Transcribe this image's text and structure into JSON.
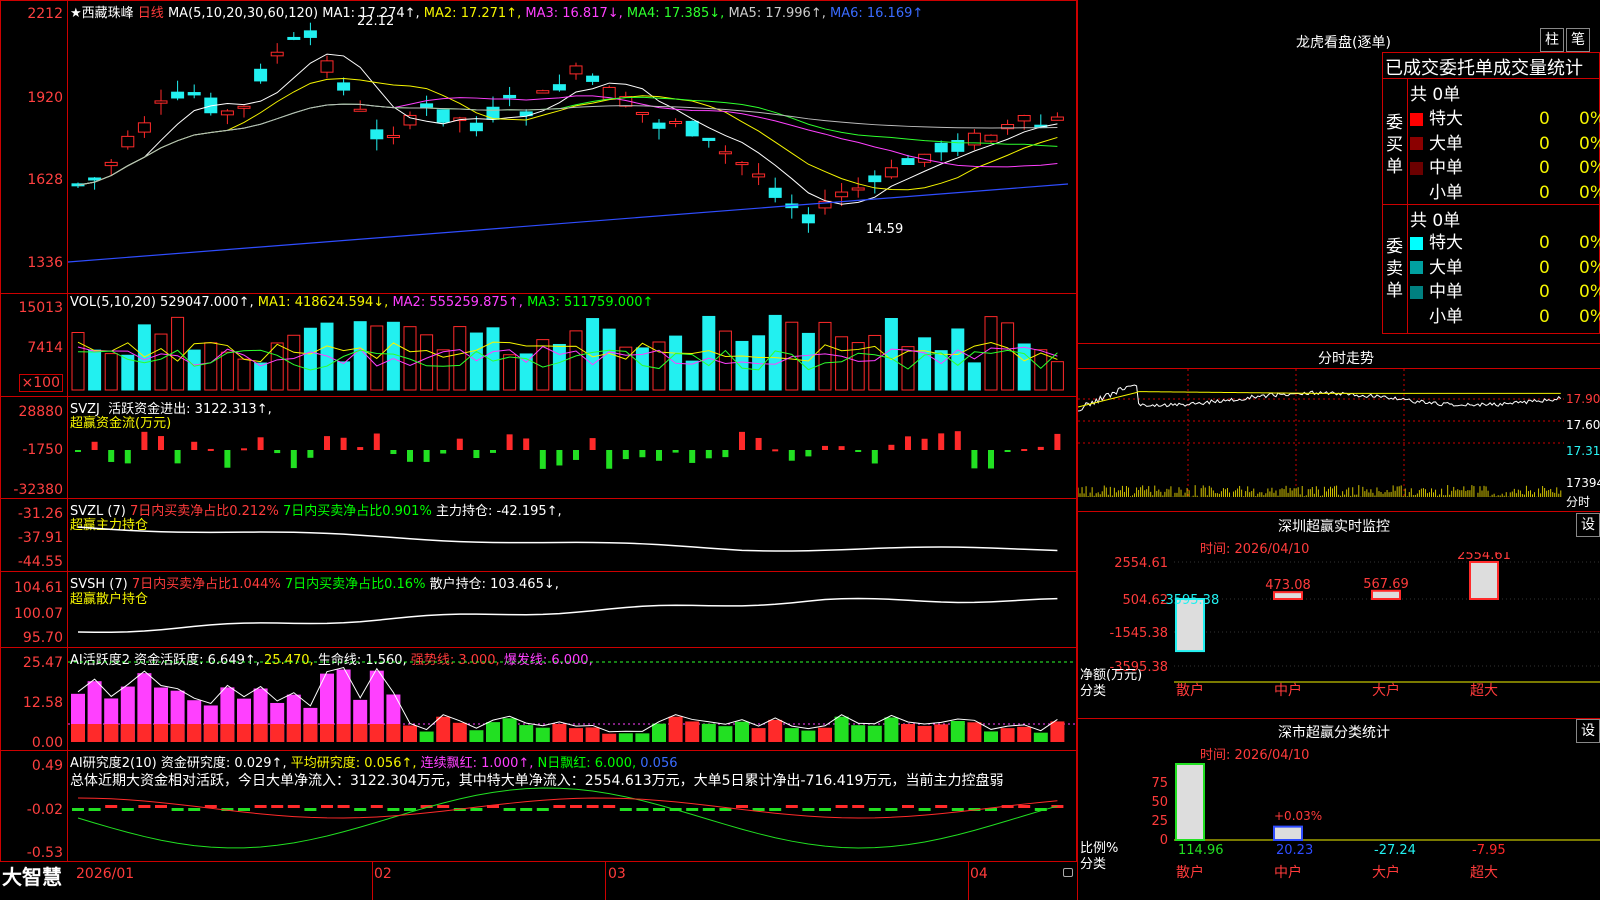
{
  "price": {
    "title": "★西藏珠峰",
    "period": "日线",
    "ma_header": "MA(5,10,20,30,60,120)",
    "ma": [
      {
        "label": "MA1: 17.274↑,",
        "color": "#ffffff"
      },
      {
        "label": "MA2: 17.271↑,",
        "color": "#f5f500"
      },
      {
        "label": "MA3: 16.817↓,",
        "color": "#ff40ff"
      },
      {
        "label": "MA4: 17.385↓,",
        "color": "#2dff2d"
      },
      {
        "label": "MA5: 17.996↑,",
        "color": "#cccccc"
      },
      {
        "label": "MA6: 16.169↑",
        "color": "#3a6bff"
      }
    ],
    "y_ticks": [
      "2212",
      "1920",
      "1628",
      "1336"
    ],
    "high_label": "22.12",
    "low_label": "14.59"
  },
  "volume": {
    "header": "VOL(5,10,20)",
    "value": "529047.000↑,",
    "ma1": "MA1: 418624.594↓,",
    "ma2": "MA2: 555259.875↑,",
    "ma3": "MA3: 511759.000↑",
    "y_ticks": [
      "15013",
      "7414",
      "×100"
    ]
  },
  "svzj": {
    "header": "SVZJ",
    "label": "活跃资金进出: 3122.313↑,",
    "sub": "超赢资金流(万元)",
    "y_ticks": [
      "28880",
      "-1750",
      "-32380"
    ]
  },
  "svzl": {
    "header": "SVZL (7)",
    "a": "7日内买卖净占比0.212%",
    "b": "7日内买卖净占比0.901%",
    "c": "主力持仓: -42.195↑,",
    "sub": "超赢主力持仓",
    "y_ticks": [
      "-31.26",
      "-37.91",
      "-44.55"
    ]
  },
  "svsh": {
    "header": "SVSH (7)",
    "a": "7日内买卖净占比1.044%",
    "b": "7日内买卖净占比0.16%",
    "c": "散户持仓: 103.465↓,",
    "sub": "超赢散户持仓",
    "y_ticks": [
      "104.61",
      "100.07",
      "95.70"
    ]
  },
  "ai2": {
    "header": "AI活跃度2",
    "a": "资金活跃度: 6.649↑,",
    "b": "25.470,",
    "c": "生命线: 1.560,",
    "d": "强势线: 3.000,",
    "e": "爆发线: 6.000,",
    "y_ticks": [
      "25.47",
      "12.58",
      "0.00"
    ]
  },
  "ai_res": {
    "header": "AI研究度2(10)",
    "a": "资金研究度: 0.029↑,",
    "b": "平均研究度: 0.056↑,",
    "c": "连续飘红: 1.000↑,",
    "d": "N日飘红: 6.000,",
    "e": "0.056",
    "summary": "总体近期大资金相对活跃，今日大单净流入：3122.304万元，其中特大单净流入：2554.613万元，大单5日累计净出-716.419万元，当前主力控盘弱",
    "y_ticks": [
      "0.49",
      "-0.02",
      "-0.53"
    ]
  },
  "footer": {
    "brand": "大智慧",
    "dates": [
      "2026/01",
      "02",
      "03",
      "04"
    ]
  },
  "dragon": {
    "title": "龙虎看盘(逐单)",
    "btn_col": "柱",
    "btn_pen": "笔",
    "header": "已成交委托单成交量统计",
    "buy_label": "委买单",
    "sell_label": "委卖单",
    "buy_total": "共 0单",
    "sell_total": "共 0单",
    "buy_rows": [
      {
        "name": "特大",
        "val": "0",
        "pct": "0%",
        "color": "#ff0000"
      },
      {
        "name": "大单",
        "val": "0",
        "pct": "0%",
        "color": "#8b0000"
      },
      {
        "name": "中单",
        "val": "0",
        "pct": "0%",
        "color": "#6b0000"
      },
      {
        "name": "小单",
        "val": "0",
        "pct": "0%",
        "color": "#000000"
      }
    ],
    "sell_rows": [
      {
        "name": "特大",
        "val": "0",
        "pct": "0%",
        "color": "#00ffff"
      },
      {
        "name": "大单",
        "val": "0",
        "pct": "0%",
        "color": "#00a0a0"
      },
      {
        "name": "中单",
        "val": "0",
        "pct": "0%",
        "color": "#008080"
      },
      {
        "name": "小单",
        "val": "0",
        "pct": "0%",
        "color": "#000000"
      }
    ]
  },
  "intraday": {
    "title": "分时走势",
    "y_ticks": [
      "17.90",
      "17.60",
      "17.31",
      "17394",
      "分时"
    ]
  },
  "sz_monitor": {
    "title": "深圳超赢实时监控",
    "btn": "设",
    "time": "时间: 2026/04/10",
    "y_ticks": [
      "2554.61",
      "504.62",
      "-1545.38",
      "-3595.38"
    ],
    "axis_label": "净额(万元)",
    "cat_label": "分类",
    "values": [
      "-3595.38",
      "473.08",
      "567.69",
      "2554.61"
    ],
    "categories": [
      "散户",
      "中户",
      "大户",
      "超大"
    ]
  },
  "sz_class": {
    "title": "深市超赢分类统计",
    "btn": "设",
    "time": "时间: 2026/04/10",
    "y_ticks": [
      "75",
      "50",
      "25",
      "0"
    ],
    "axis_label": "比例%",
    "cat_label": "分类",
    "values": [
      "114.96",
      "20.23",
      "-27.24",
      "-7.95"
    ],
    "note": "+0.03%",
    "categories": [
      "散户",
      "中户",
      "大户",
      "超大"
    ]
  }
}
